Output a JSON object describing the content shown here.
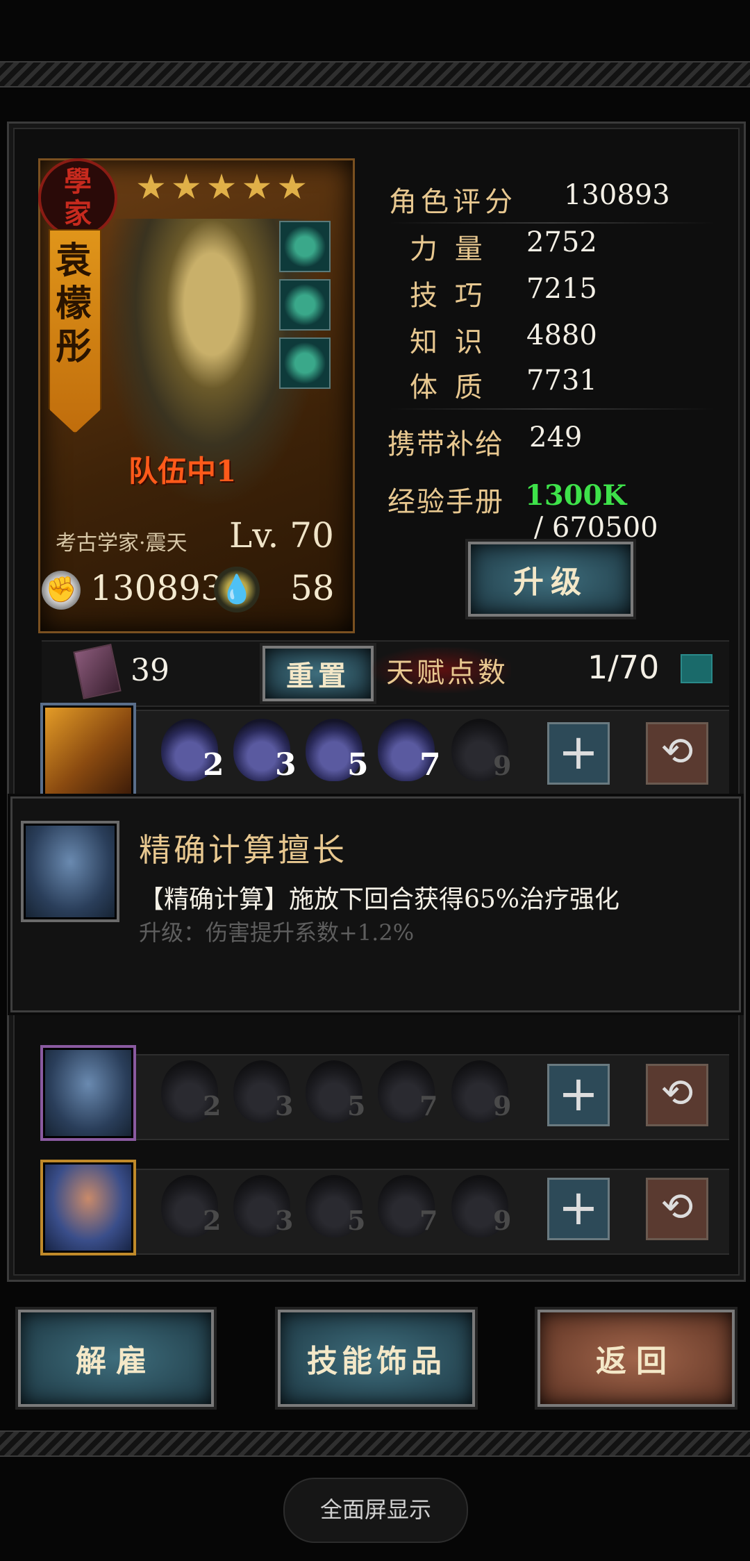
{
  "hero": {
    "class_badge": [
      "學",
      "家"
    ],
    "name_chars": [
      "袁",
      "檬",
      "彤"
    ],
    "stars": "★★★★★",
    "team_label": "队伍中1",
    "subclass": "考古学家·震天",
    "level": "Lv. 70",
    "power": "130893",
    "supply_points": "58",
    "equipment": [
      "pendant-icon",
      "ring-icon",
      "gem-icon"
    ]
  },
  "stats": [
    {
      "label": "角色评分",
      "value": "130893"
    },
    {
      "label": "力 量",
      "value": "2752"
    },
    {
      "label": "技 巧",
      "value": "7215"
    },
    {
      "label": "知 识",
      "value": "4880"
    },
    {
      "label": "体 质",
      "value": "7731"
    },
    {
      "label": "携带补给",
      "value": "249"
    }
  ],
  "exp": {
    "label": "经验手册",
    "current": "1300K",
    "sep": " / ",
    "required": "670500",
    "current_color": "#3ee24a"
  },
  "upgrade_label": "升级",
  "talent": {
    "book_count": "39",
    "reset_label": "重置",
    "points_label": "天赋点数",
    "points_value": "1/70"
  },
  "skill_rows": [
    {
      "levels": [
        "2",
        "3",
        "5",
        "7",
        "9"
      ],
      "active": [
        true,
        true,
        true,
        true,
        false
      ],
      "icon": "blade-skill-icon"
    },
    {
      "levels": [
        "2",
        "3",
        "5",
        "7",
        "9"
      ],
      "active": [
        false,
        false,
        false,
        false,
        false
      ],
      "icon": "scholar-skill-icon"
    },
    {
      "levels": [
        "2",
        "3",
        "5",
        "7",
        "9"
      ],
      "active": [
        false,
        false,
        false,
        false,
        false
      ],
      "icon": "strength-skill-icon"
    }
  ],
  "tooltip": {
    "title": "精确计算擅长",
    "desc": "【精确计算】施放下回合获得65%治疗强化",
    "upgrade": "升级：伤害提升系数+1.2%"
  },
  "footer": {
    "dismiss_label": "解雇",
    "skill_items_label": "技能饰品",
    "back_label": "返回"
  },
  "fullscreen_label": "全面屏显示"
}
